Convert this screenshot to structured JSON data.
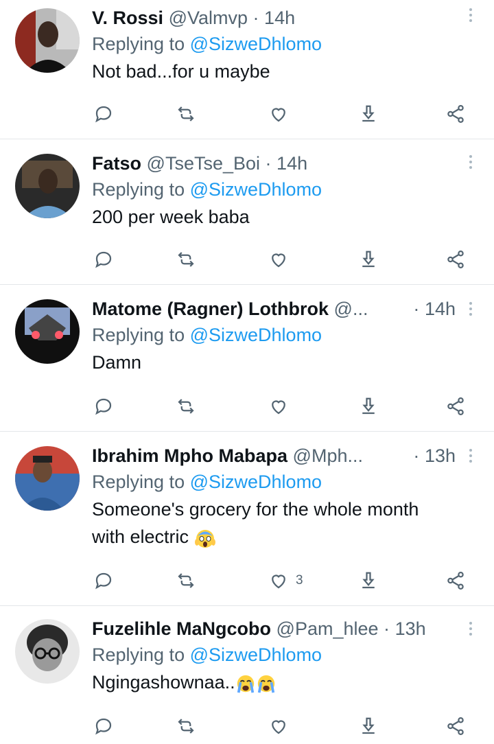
{
  "replies": [
    {
      "name": "V. Rossi",
      "handle": "@Valmvp",
      "dot": "·",
      "time": "14h",
      "replying_prefix": "Replying to",
      "replying_mention": "@SizweDhlomo",
      "text": "Not bad...for u maybe",
      "like_count": ""
    },
    {
      "name": "Fatso",
      "handle": "@TseTse_Boi",
      "dot": "·",
      "time": "14h",
      "replying_prefix": "Replying to",
      "replying_mention": "@SizweDhlomo",
      "text": "200 per week baba",
      "like_count": ""
    },
    {
      "name": "Matome (Ragner) Lothbrok",
      "handle": "@...",
      "dot": "·",
      "time": "14h",
      "replying_prefix": "Replying to",
      "replying_mention": "@SizweDhlomo",
      "text": "Damn",
      "like_count": ""
    },
    {
      "name": "Ibrahim Mpho Mabapa",
      "handle": "@Mph...",
      "dot": "·",
      "time": "13h",
      "replying_prefix": "Replying to",
      "replying_mention": "@SizweDhlomo",
      "text": "Someone's grocery for the whole month",
      "text2": "with electric",
      "like_count": "3"
    },
    {
      "name": "Fuzelihle MaNgcobo",
      "handle": "@Pam_hlee",
      "dot": "·",
      "time": "13h",
      "replying_prefix": "Replying to",
      "replying_mention": "@SizweDhlomo",
      "text": "Ngingashownaa..",
      "like_count": ""
    }
  ],
  "icons": {
    "reply": "speech-bubble-icon",
    "retweet": "retweet-icon",
    "like": "heart-icon",
    "download": "download-icon",
    "share": "share-icon",
    "menu": "more-vertical-icon"
  },
  "colors": {
    "mention": "#1d9bf0",
    "muted": "#536471",
    "text": "#0f1419",
    "divider": "#e3e6e9"
  }
}
